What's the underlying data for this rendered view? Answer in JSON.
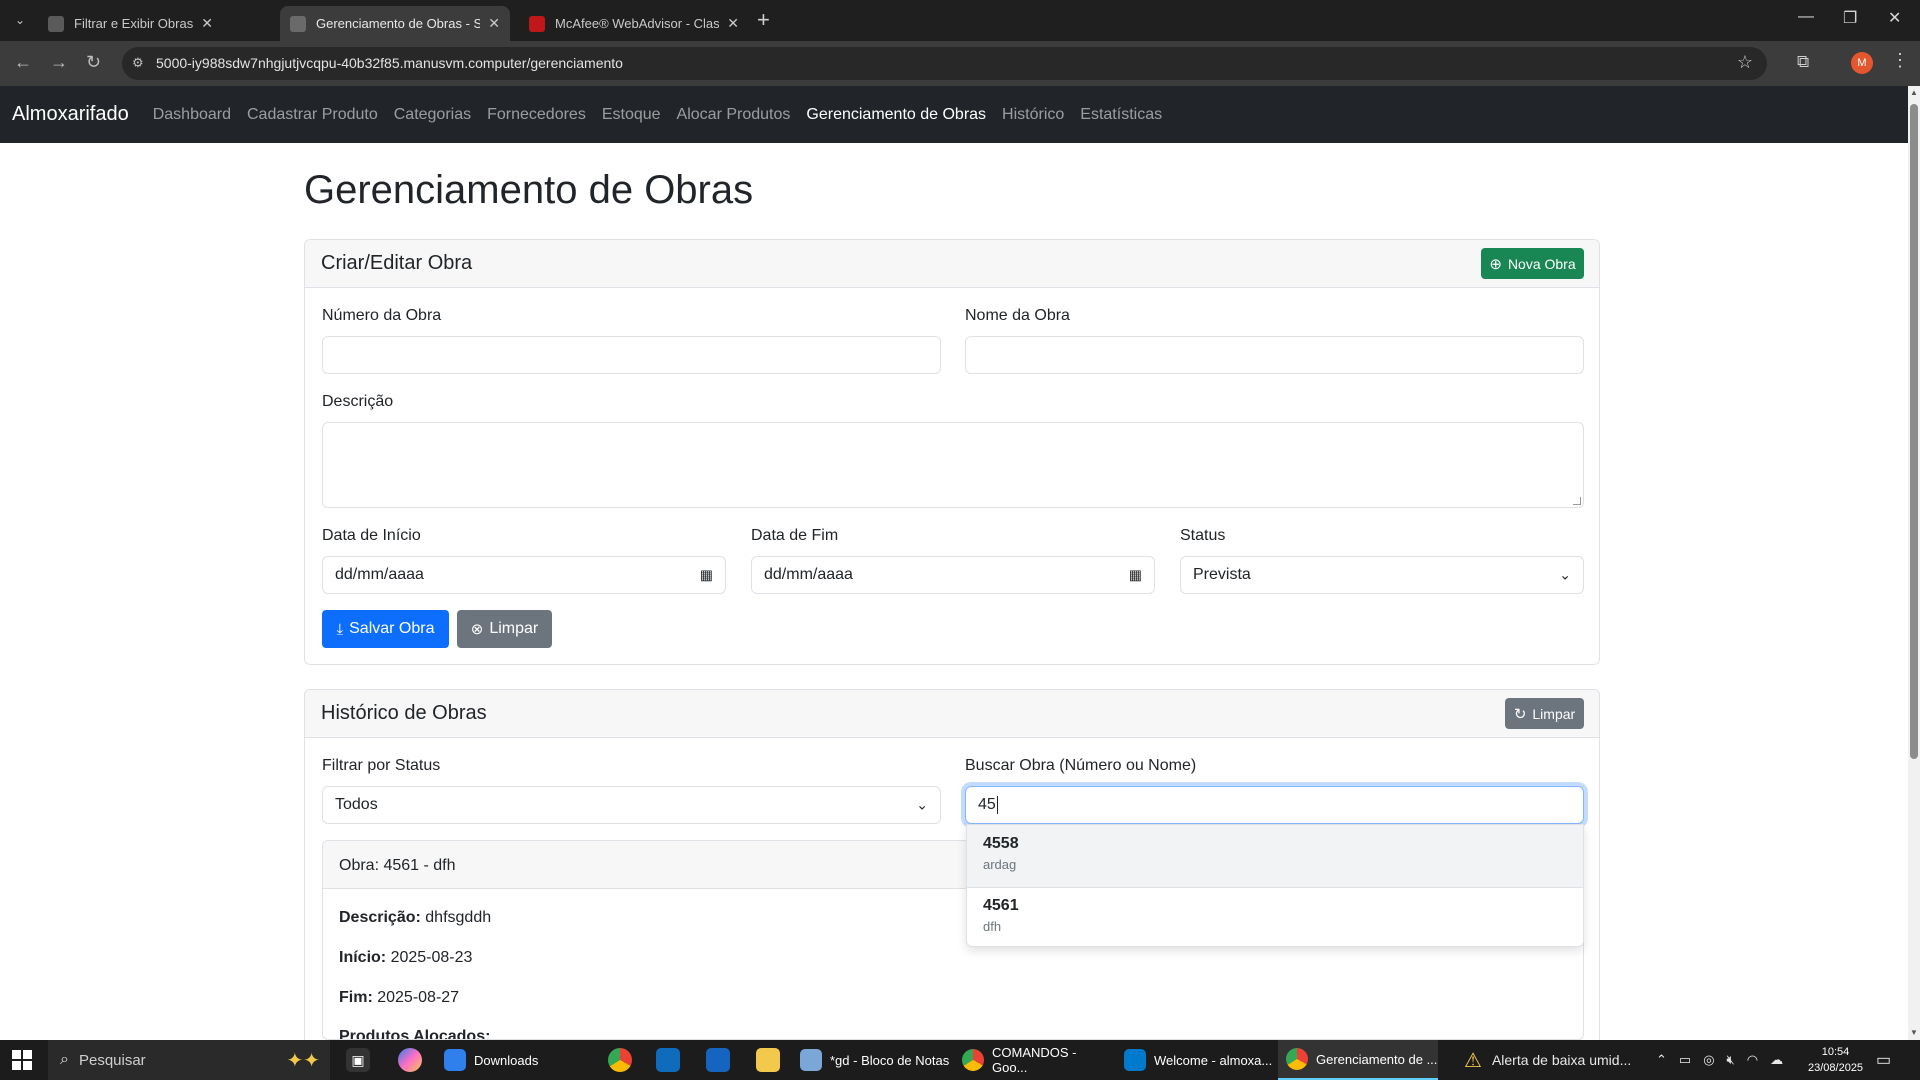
{
  "browser": {
    "tabs": [
      {
        "title": "Filtrar e Exibir Obras por Status",
        "active": false
      },
      {
        "title": "Gerenciamento de Obras - Siste",
        "active": true
      },
      {
        "title": "McAfee® WebAdvisor - Classifi",
        "active": false
      }
    ],
    "url": "5000-iy988sdw7nhgjutjvcqpu-40b32f85.manusvm.computer/gerenciamento",
    "profile_initial": "M"
  },
  "navbar": {
    "brand": "Almoxarifado",
    "links": [
      {
        "label": "Dashboard",
        "active": false
      },
      {
        "label": "Cadastrar Produto",
        "active": false
      },
      {
        "label": "Categorias",
        "active": false
      },
      {
        "label": "Fornecedores",
        "active": false
      },
      {
        "label": "Estoque",
        "active": false
      },
      {
        "label": "Alocar Produtos",
        "active": false
      },
      {
        "label": "Gerenciamento de Obras",
        "active": true
      },
      {
        "label": "Histórico",
        "active": false
      },
      {
        "label": "Estatísticas",
        "active": false
      }
    ]
  },
  "page": {
    "title": "Gerenciamento de Obras"
  },
  "form_card": {
    "header": "Criar/Editar Obra",
    "new_button": "Nova Obra",
    "numero_label": "Número da Obra",
    "numero_value": "",
    "nome_label": "Nome da Obra",
    "nome_value": "",
    "descricao_label": "Descrição",
    "descricao_value": "",
    "data_inicio_label": "Data de Início",
    "data_inicio_placeholder": "dd/mm/aaaa",
    "data_fim_label": "Data de Fim",
    "data_fim_placeholder": "dd/mm/aaaa",
    "status_label": "Status",
    "status_value": "Prevista",
    "save_button": "Salvar Obra",
    "clear_button": "Limpar"
  },
  "history_card": {
    "header": "Histórico de Obras",
    "clear_button": "Limpar",
    "filter_label": "Filtrar por Status",
    "filter_value": "Todos",
    "search_label": "Buscar Obra (Número ou Nome)",
    "search_value": "45",
    "obra": {
      "header": "Obra: 4561 - dfh",
      "descricao_label": "Descrição:",
      "descricao_value": "dhfsgddh",
      "inicio_label": "Início:",
      "inicio_value": "2025-08-23",
      "fim_label": "Fim:",
      "fim_value": "2025-08-27",
      "produtos_label": "Produtos Alocados:"
    },
    "suggestions": [
      {
        "numero": "4558",
        "nome": "ardag"
      },
      {
        "numero": "4561",
        "nome": "dfh"
      }
    ]
  },
  "taskbar": {
    "search_placeholder": "Pesquisar",
    "items": [
      {
        "label": "Downloads"
      },
      {
        "label": "*gd - Bloco de Notas"
      },
      {
        "label": "COMANDOS - Goo..."
      },
      {
        "label": "Welcome - almoxa..."
      },
      {
        "label": "Gerenciamento de ..."
      }
    ],
    "alert": "Alerta de baixa umid...",
    "time": "10:54",
    "date": "23/08/2025"
  },
  "colors": {
    "navbar_bg": "#212529",
    "primary": "#0d6efd",
    "success": "#198754",
    "secondary": "#6c757d"
  }
}
